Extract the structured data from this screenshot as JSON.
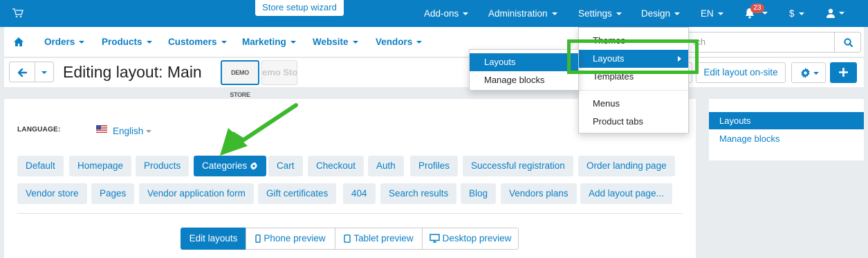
{
  "topbar": {
    "wizard_label": "Store setup wizard",
    "items": [
      "Add-ons",
      "Administration",
      "Settings",
      "Design",
      "EN"
    ],
    "notification_count": "23",
    "currency_label": "$"
  },
  "subnav": {
    "items": [
      "Orders",
      "Products",
      "Customers",
      "Marketing",
      "Website",
      "Vendors"
    ],
    "search_placeholder": "rch"
  },
  "titlebar": {
    "title": "Editing layout: Main",
    "logo1_text": "DEMO STORE",
    "logo2_text": "emo Sto",
    "edit_onsite_label": "Edit layout on-site"
  },
  "design_menu": {
    "items": [
      "Themes",
      "Layouts",
      "Templates",
      "Menus",
      "Product tabs"
    ]
  },
  "layouts_submenu": {
    "items": [
      "Layouts",
      "Manage blocks"
    ]
  },
  "language": {
    "label": "LANGUAGE:",
    "value": "English"
  },
  "layout_pages": {
    "row1": [
      "Default",
      "Homepage",
      "Products",
      "Categories",
      "Cart",
      "Checkout",
      "Auth",
      "Profiles",
      "Successful registration",
      "Order landing page"
    ],
    "row2": [
      "Vendor store",
      "Pages",
      "Vendor application form",
      "Gift certificates",
      "404",
      "Search results",
      "Blog",
      "Vendors plans",
      "Add layout page..."
    ],
    "active": "Categories"
  },
  "view_modes": {
    "items": [
      "Edit layouts",
      "Phone preview",
      "Tablet preview",
      "Desktop preview"
    ],
    "active": "Edit layouts"
  },
  "sidebar": {
    "items": [
      "Layouts",
      "Manage blocks"
    ]
  },
  "colors": {
    "brand": "#0b7fc4",
    "highlight": "#3db92d",
    "badge": "#d9534f"
  }
}
